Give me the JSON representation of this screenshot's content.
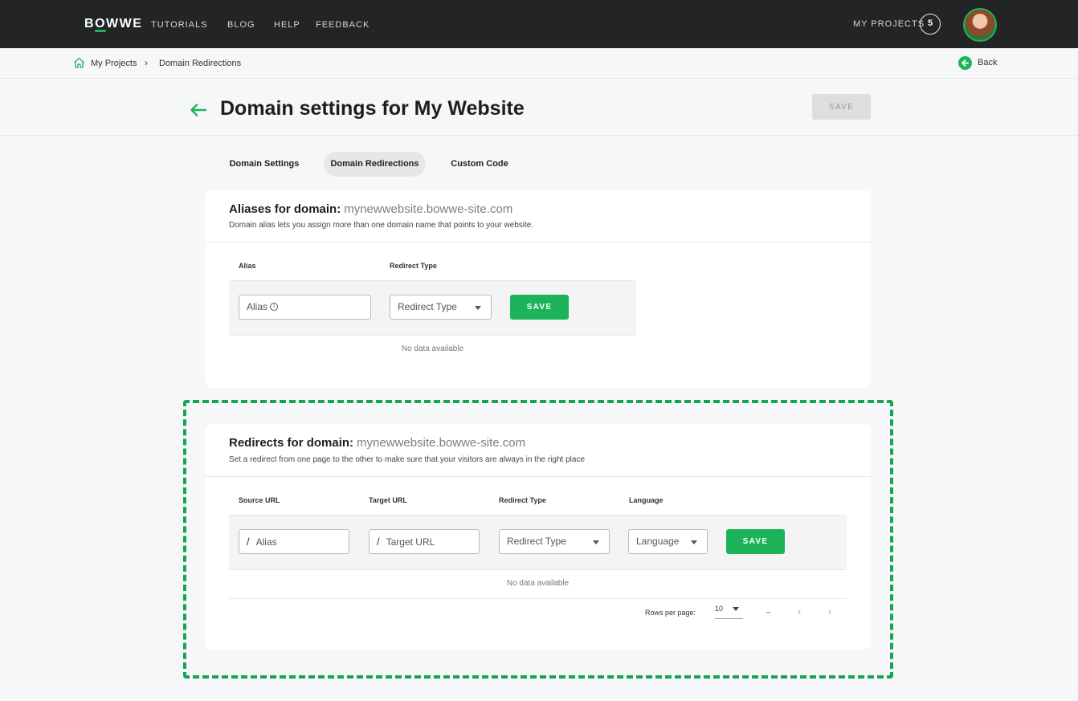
{
  "header": {
    "logo": {
      "pre": "B",
      "o": "O",
      "post": "WWE"
    },
    "nav": [
      "TUTORIALS",
      "BLOG",
      "HELP",
      "FEEDBACK"
    ],
    "my_projects_label": "MY PROJECTS",
    "project_count": "5"
  },
  "breadcrumb": {
    "home_label": "My Projects",
    "separator": "›",
    "current": "Domain Redirections",
    "back_label": "Back"
  },
  "page": {
    "title": "Domain settings for My Website",
    "save_label": "SAVE"
  },
  "tabs": [
    {
      "label": "Domain Settings",
      "active": false
    },
    {
      "label": "Domain Redirections",
      "active": true
    },
    {
      "label": "Custom Code",
      "active": false
    }
  ],
  "aliases": {
    "title": "Aliases for domain:",
    "domain": "mynewwebsite.bowwe-site.com",
    "description": "Domain alias lets you assign more than one domain name that points to your website.",
    "columns": [
      "Alias",
      "Redirect Type"
    ],
    "alias_placeholder": "Alias",
    "redirect_type_placeholder": "Redirect Type",
    "save_label": "SAVE",
    "empty": "No data available"
  },
  "redirects": {
    "title": "Redirects for domain:",
    "domain": "mynewwebsite.bowwe-site.com",
    "description": "Set a redirect from one page to the other to make sure that your visitors are always in the right place",
    "columns": [
      "Source URL",
      "Target URL",
      "Redirect Type",
      "Language"
    ],
    "slash": "/",
    "source_placeholder": "Alias",
    "target_placeholder": "Target URL",
    "redirect_type_placeholder": "Redirect Type",
    "language_placeholder": "Language",
    "save_label": "SAVE",
    "empty": "No data available",
    "pagination": {
      "rows_label": "Rows per page:",
      "rows_value": "10",
      "range": "–",
      "prev": "‹",
      "next": "›"
    }
  },
  "colors": {
    "accent": "#1db35a",
    "topbar": "#222426",
    "highlight": "#13a552"
  },
  "icons": [
    "home-icon",
    "back-icon",
    "arrow-left-icon",
    "info-icon",
    "caret-down-icon",
    "chevron-left-icon",
    "chevron-right-icon"
  ]
}
